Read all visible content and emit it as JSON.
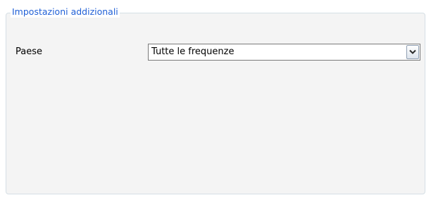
{
  "group": {
    "title": "Impostazioni addizionali"
  },
  "country": {
    "label": "Paese",
    "selected": "Tutte le frequenze"
  },
  "icons": {
    "dropdown": "chevron-down-icon"
  },
  "colors": {
    "group_title": "#1f5fd6",
    "group_border": "#d5dfe5",
    "panel_background": "#f4f4f4",
    "combo_border": "#7a7a7a"
  }
}
